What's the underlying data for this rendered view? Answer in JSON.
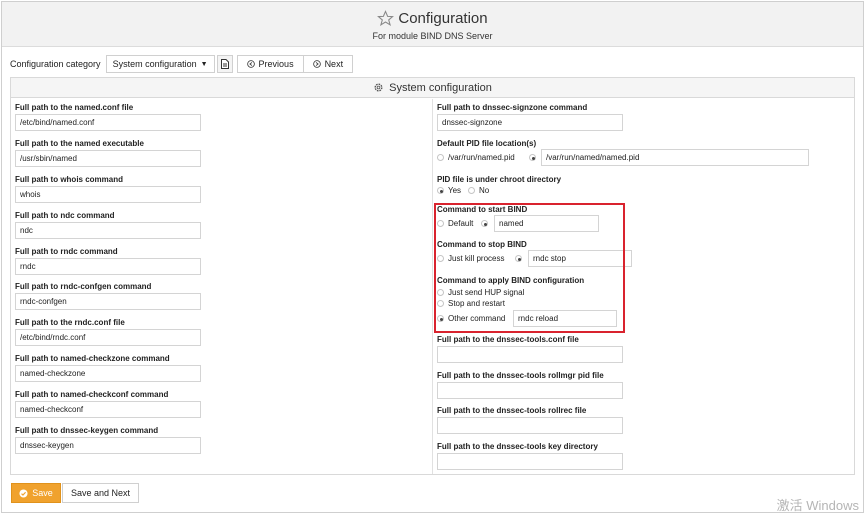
{
  "header": {
    "title": "Configuration",
    "subtitle": "For module BIND DNS Server"
  },
  "toolbar": {
    "category_label": "Configuration category",
    "category_value": "System configuration",
    "previous_label": "Previous",
    "next_label": "Next"
  },
  "panel": {
    "title": "System configuration"
  },
  "left_fields": [
    {
      "label": "Full path to the named.conf file",
      "value": "/etc/bind/named.conf"
    },
    {
      "label": "Full path to the named executable",
      "value": "/usr/sbin/named"
    },
    {
      "label": "Full path to whois command",
      "value": "whois"
    },
    {
      "label": "Full path to ndc command",
      "value": "ndc"
    },
    {
      "label": "Full path to rndc command",
      "value": "rndc"
    },
    {
      "label": "Full path to rndc-confgen command",
      "value": "rndc-confgen"
    },
    {
      "label": "Full path to the rndc.conf file",
      "value": "/etc/bind/rndc.conf"
    },
    {
      "label": "Full path to named-checkzone command",
      "value": "named-checkzone"
    },
    {
      "label": "Full path to named-checkconf command",
      "value": "named-checkconf"
    },
    {
      "label": "Full path to dnssec-keygen command",
      "value": "dnssec-keygen"
    }
  ],
  "right": {
    "signzone": {
      "label": "Full path to dnssec-signzone command",
      "value": "dnssec-signzone"
    },
    "pid": {
      "label": "Default PID file location(s)",
      "option1": "/var/run/named.pid",
      "value": "/var/run/named/named.pid"
    },
    "chroot": {
      "label": "PID file is under chroot directory",
      "yes": "Yes",
      "no": "No"
    },
    "start": {
      "label": "Command to start BIND",
      "default": "Default",
      "value": "named"
    },
    "stop": {
      "label": "Command to stop BIND",
      "kill": "Just kill process",
      "value": "rndc stop"
    },
    "apply": {
      "label": "Command to apply BIND configuration",
      "hup": "Just send HUP signal",
      "restart": "Stop and restart",
      "other": "Other command",
      "value": "rndc reload"
    },
    "tools_conf": {
      "label": "Full path to the dnssec-tools.conf file",
      "value": ""
    },
    "rollmgr": {
      "label": "Full path to the dnssec-tools rollmgr pid file",
      "value": ""
    },
    "rollrec": {
      "label": "Full path to the dnssec-tools rollrec file",
      "value": ""
    },
    "keydir": {
      "label": "Full path to the dnssec-tools key directory",
      "value": ""
    }
  },
  "footer": {
    "save_label": "Save",
    "save_next_label": "Save and Next"
  },
  "watermark": "激活 Windows",
  "colors": {
    "accent": "#f0a22e",
    "highlight": "#d9232e"
  }
}
